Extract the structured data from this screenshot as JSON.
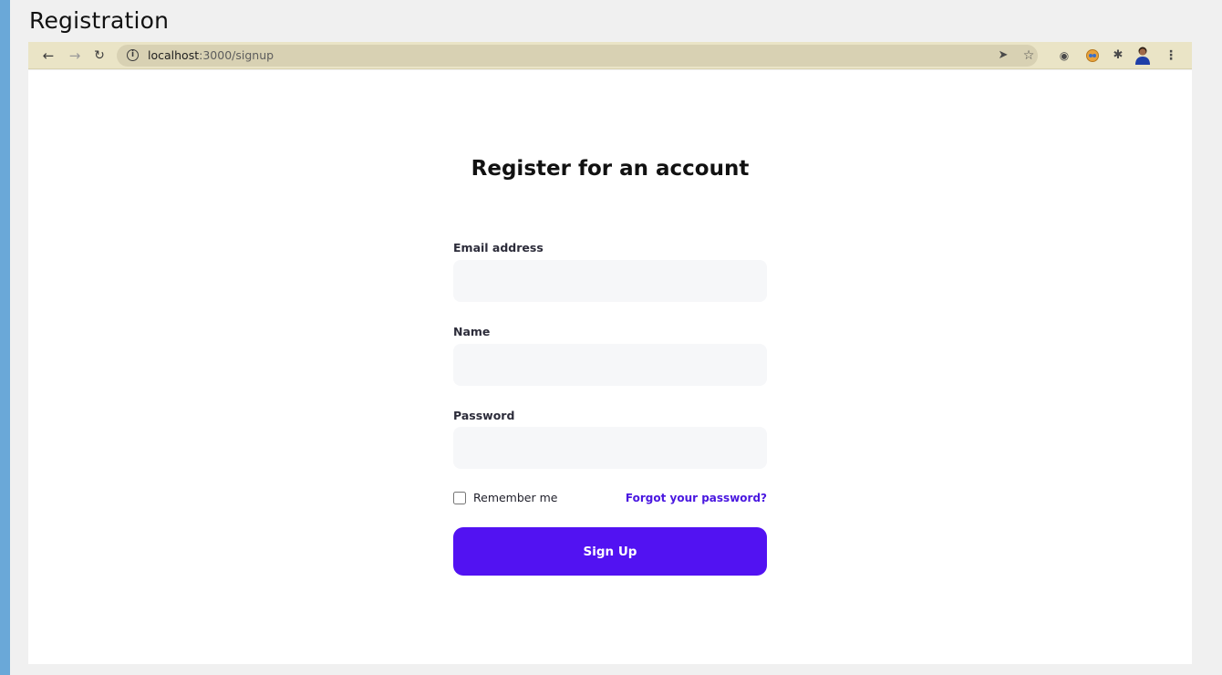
{
  "slide": {
    "title": "Registration"
  },
  "browser": {
    "url_host": "localhost",
    "url_path": ":3000/signup",
    "icons": {
      "back": "arrow-left-icon",
      "forward": "arrow-right-icon",
      "reload": "reload-icon",
      "info": "info-icon",
      "send": "send-icon",
      "bookmark": "star-icon",
      "camera": "camera-icon",
      "extension_face": "extension-face-icon",
      "extensions": "puzzle-icon",
      "profile": "avatar-icon",
      "menu": "kebab-menu-icon"
    }
  },
  "form": {
    "heading": "Register for an account",
    "email_label": "Email address",
    "email_value": "",
    "name_label": "Name",
    "name_value": "",
    "password_label": "Password",
    "password_value": "",
    "remember_label": "Remember me",
    "remember_checked": false,
    "forgot_link": "Forgot your password?",
    "submit_label": "Sign Up"
  },
  "colors": {
    "accent": "#5212f2",
    "link": "#4a18e0",
    "browser_bar": "#eae4c6",
    "input_bg": "#f6f7f9",
    "slide_accent": "#6aa8d8"
  }
}
